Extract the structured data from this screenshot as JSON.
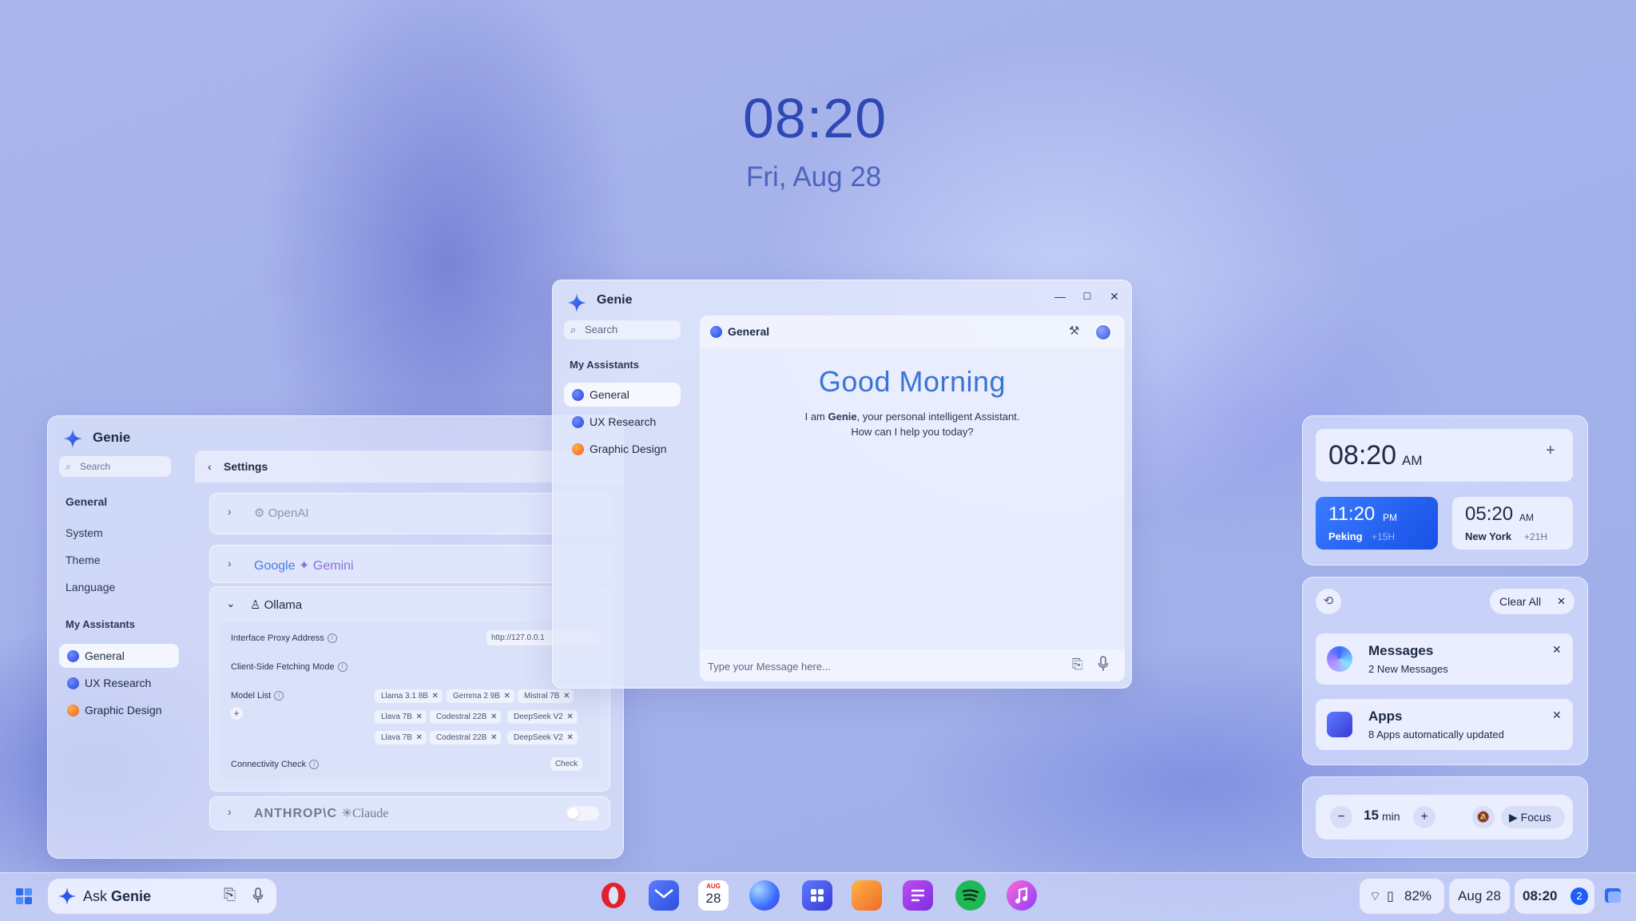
{
  "lock_screen": {
    "time": "08:20",
    "date": "Fri, Aug 28"
  },
  "settings_window": {
    "app_title": "Genie",
    "search_placeholder": "Search",
    "sidebar": {
      "section_general": "General",
      "items": [
        "System",
        "Theme",
        "Language"
      ],
      "section_assistants": "My Assistants",
      "assistants": [
        {
          "label": "General",
          "color": "#2845d8",
          "active": true
        },
        {
          "label": "UX Research",
          "color": "#2845d8",
          "active": false
        },
        {
          "label": "Graphic Design",
          "color": "#f05a28",
          "active": false
        }
      ]
    },
    "header": {
      "back_icon": "chevron-left-icon",
      "title": "Settings"
    },
    "providers": {
      "openai": "OpenAI",
      "google": "Google",
      "gemini": "✦ Gemini",
      "ollama": "Ollama",
      "anthropic": "ANTHROP\\C",
      "claude": "✳Claude"
    },
    "ollama": {
      "proxy_label": "Interface Proxy Address",
      "proxy_value": "http://127.0.0.1",
      "fetch_label": "Client-Side Fetching Mode",
      "model_list_label": "Model List",
      "models": [
        "Llama 3.1 8B",
        "Gemma 2 9B",
        "Mistral 7B",
        "Llava 7B",
        "Codestral 22B",
        "DeepSeek V2",
        "Llava 7B",
        "Codestral 22B",
        "DeepSeek V2"
      ],
      "add_label": "+",
      "connectivity_label": "Connectivity Check",
      "check_button": "Check"
    }
  },
  "chat_window": {
    "app_title": "Genie",
    "controls": {
      "minimize": "—",
      "maximize": "☐",
      "close": "✕"
    },
    "search_placeholder": "Search",
    "section_title": "My Assistants",
    "assistants": [
      {
        "label": "General",
        "color": "#2845d8",
        "active": true
      },
      {
        "label": "UX Research",
        "color": "#2845d8",
        "active": false
      },
      {
        "label": "Graphic Design",
        "color": "#f05a28",
        "active": false
      }
    ],
    "pane_title": "General",
    "greeting": "Good Morning",
    "intro_prefix": "I am ",
    "intro_name": "Genie",
    "intro_suffix": ", your personal intelligent Assistant.",
    "intro_line2": "How can I help you today?",
    "message_placeholder": "Type your Message here..."
  },
  "clock_widget": {
    "local_time": "08:20",
    "local_ampm": "AM",
    "add_label": "+",
    "zones": [
      {
        "time": "11:20",
        "ampm": "PM",
        "city": "Peking",
        "offset": "+15H"
      },
      {
        "time": "05:20",
        "ampm": "AM",
        "city": "New York",
        "offset": "+21H"
      }
    ]
  },
  "notifications": {
    "clear_all": "Clear All",
    "items": [
      {
        "title": "Messages",
        "subtitle": "2 New Messages"
      },
      {
        "title": "Apps",
        "subtitle": "8 Apps automatically updated"
      }
    ]
  },
  "focus_widget": {
    "minus": "−",
    "duration": "15",
    "unit": "min",
    "plus": "+",
    "focus_label": "Focus"
  },
  "taskbar": {
    "ask_prefix": "Ask",
    "ask_name": "Genie",
    "apps": [
      "opera-icon",
      "mail-icon",
      "calendar-icon",
      "browser-icon",
      "app-store-icon",
      "files-icon",
      "notes-icon",
      "spotify-icon",
      "music-icon"
    ],
    "calendar_month": "AUG",
    "calendar_day": "28",
    "battery": "82%",
    "date": "Aug 28",
    "time": "08:20",
    "notification_count": "2"
  },
  "colors": {
    "accent_blue": "#1d5ef5",
    "greeting": "#3b74d4",
    "orange": "#f05a28"
  }
}
